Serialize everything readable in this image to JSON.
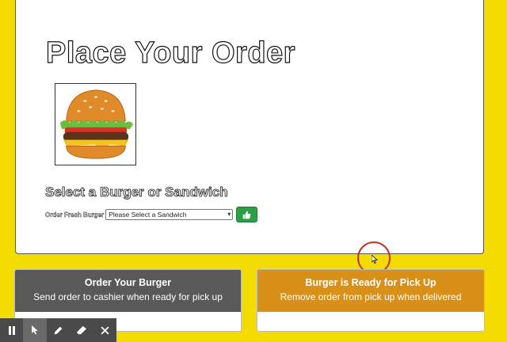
{
  "order": {
    "title": "Place Your Order",
    "section_heading": "Select a Burger or Sandwich",
    "select_label": "Order Fresh Burger",
    "select_value": "Please Select a Sandwich",
    "submit_icon": "thumbs-up-icon",
    "image_icon": "burger-image"
  },
  "panels": {
    "left": {
      "title": "Order Your Burger",
      "subtitle": "Send order to cashier when ready for pick up",
      "color": "#595959"
    },
    "right": {
      "title": "Burger is Ready for Pick Up",
      "subtitle": "Remove order from pick up when delivered",
      "color": "#d99019"
    }
  },
  "toolbar": {
    "items": [
      "pause-icon",
      "pointer-icon",
      "pen-icon",
      "eraser-icon",
      "close-icon"
    ]
  },
  "colors": {
    "background": "#f5dc00",
    "submit": "#2e9e46",
    "cursor_ring": "#c03020"
  }
}
